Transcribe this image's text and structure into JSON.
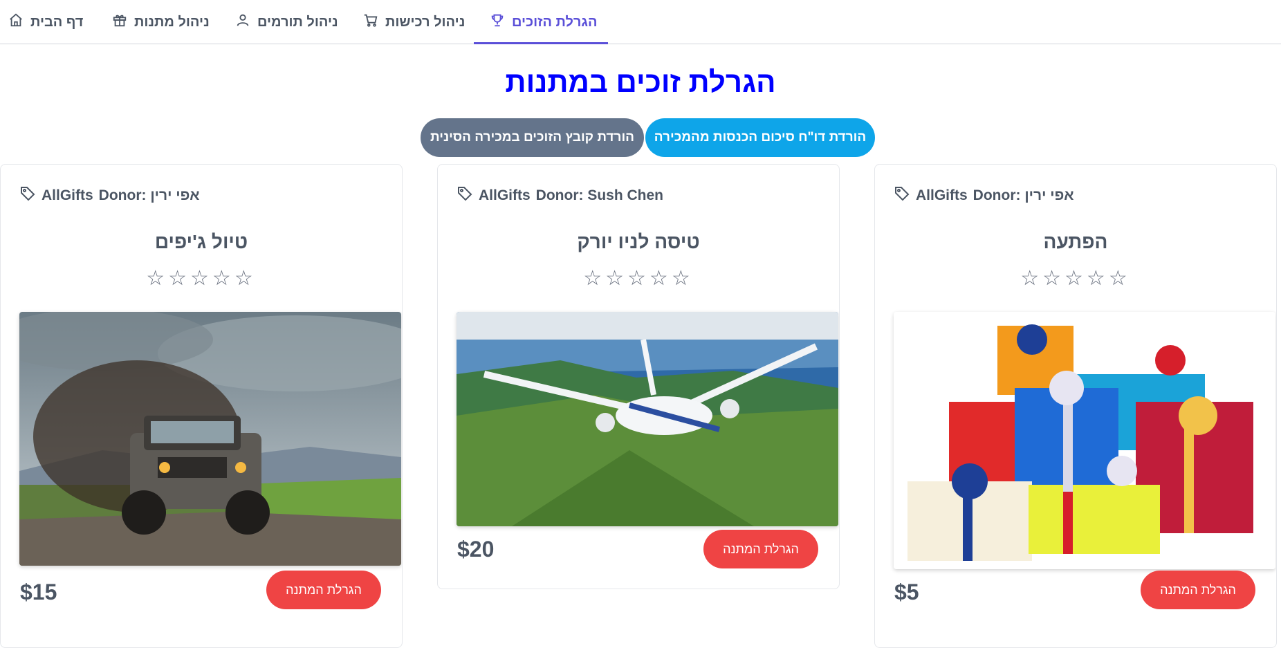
{
  "nav": {
    "home": "דף הבית",
    "gifts": "ניהול מתנות",
    "donors": "ניהול תורמים",
    "purchases": "ניהול רכישות",
    "raffle": "הגרלת הזוכים"
  },
  "page_title": "הגרלת זוכים במתנות",
  "buttons": {
    "download_revenue": "הורדת דו\"ח סיכום הכנסות מהמכירה",
    "download_winners": "הורדת קובץ הזוכים במכירה הסינית"
  },
  "cards": [
    {
      "category": "AllGifts",
      "donor": "Donor: אפי ירין",
      "name": "טיול ג'יפים",
      "stars": "☆☆☆☆☆",
      "price": "$15",
      "raffle_label": "הגרלת המתנה",
      "image_icon": "jeep-photo"
    },
    {
      "category": "AllGifts",
      "donor": "Donor: Sush Chen",
      "name": "טיסה לניו יורק",
      "stars": "☆☆☆☆☆",
      "price": "$20",
      "raffle_label": "הגרלת המתנה",
      "image_icon": "airplane-photo"
    },
    {
      "category": "AllGifts",
      "donor": "Donor: אפי ירין",
      "name": "הפתעה",
      "stars": "☆☆☆☆☆",
      "price": "$5",
      "raffle_label": "הגרלת המתנה",
      "image_icon": "gift-boxes-photo"
    }
  ],
  "colors": {
    "accent": "#5a4fd8",
    "title": "#0000ff",
    "primary_button": "#0ea5e9",
    "secondary_button": "#64748b",
    "raffle_button": "#ef4444"
  }
}
